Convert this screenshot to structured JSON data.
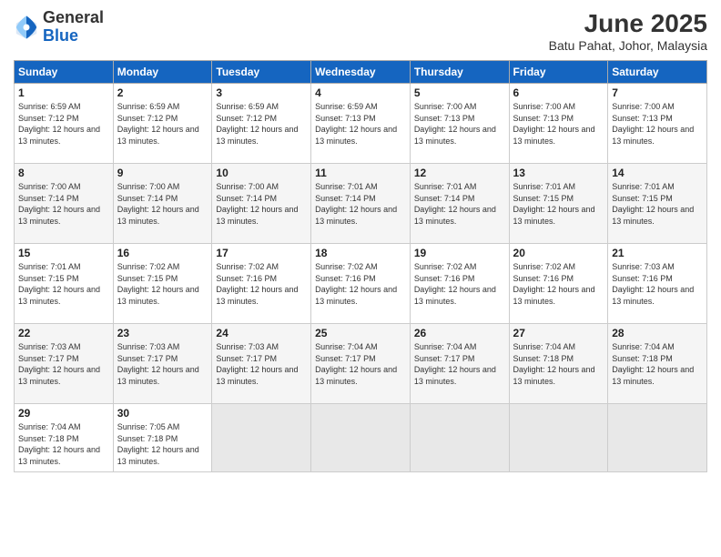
{
  "logo": {
    "general": "General",
    "blue": "Blue"
  },
  "title": "June 2025",
  "subtitle": "Batu Pahat, Johor, Malaysia",
  "weekdays": [
    "Sunday",
    "Monday",
    "Tuesday",
    "Wednesday",
    "Thursday",
    "Friday",
    "Saturday"
  ],
  "weeks": [
    [
      {
        "day": "1",
        "sunrise": "6:59 AM",
        "sunset": "7:12 PM",
        "daylight": "12 hours and 13 minutes."
      },
      {
        "day": "2",
        "sunrise": "6:59 AM",
        "sunset": "7:12 PM",
        "daylight": "12 hours and 13 minutes."
      },
      {
        "day": "3",
        "sunrise": "6:59 AM",
        "sunset": "7:12 PM",
        "daylight": "12 hours and 13 minutes."
      },
      {
        "day": "4",
        "sunrise": "6:59 AM",
        "sunset": "7:13 PM",
        "daylight": "12 hours and 13 minutes."
      },
      {
        "day": "5",
        "sunrise": "7:00 AM",
        "sunset": "7:13 PM",
        "daylight": "12 hours and 13 minutes."
      },
      {
        "day": "6",
        "sunrise": "7:00 AM",
        "sunset": "7:13 PM",
        "daylight": "12 hours and 13 minutes."
      },
      {
        "day": "7",
        "sunrise": "7:00 AM",
        "sunset": "7:13 PM",
        "daylight": "12 hours and 13 minutes."
      }
    ],
    [
      {
        "day": "8",
        "sunrise": "7:00 AM",
        "sunset": "7:14 PM",
        "daylight": "12 hours and 13 minutes."
      },
      {
        "day": "9",
        "sunrise": "7:00 AM",
        "sunset": "7:14 PM",
        "daylight": "12 hours and 13 minutes."
      },
      {
        "day": "10",
        "sunrise": "7:00 AM",
        "sunset": "7:14 PM",
        "daylight": "12 hours and 13 minutes."
      },
      {
        "day": "11",
        "sunrise": "7:01 AM",
        "sunset": "7:14 PM",
        "daylight": "12 hours and 13 minutes."
      },
      {
        "day": "12",
        "sunrise": "7:01 AM",
        "sunset": "7:14 PM",
        "daylight": "12 hours and 13 minutes."
      },
      {
        "day": "13",
        "sunrise": "7:01 AM",
        "sunset": "7:15 PM",
        "daylight": "12 hours and 13 minutes."
      },
      {
        "day": "14",
        "sunrise": "7:01 AM",
        "sunset": "7:15 PM",
        "daylight": "12 hours and 13 minutes."
      }
    ],
    [
      {
        "day": "15",
        "sunrise": "7:01 AM",
        "sunset": "7:15 PM",
        "daylight": "12 hours and 13 minutes."
      },
      {
        "day": "16",
        "sunrise": "7:02 AM",
        "sunset": "7:15 PM",
        "daylight": "12 hours and 13 minutes."
      },
      {
        "day": "17",
        "sunrise": "7:02 AM",
        "sunset": "7:16 PM",
        "daylight": "12 hours and 13 minutes."
      },
      {
        "day": "18",
        "sunrise": "7:02 AM",
        "sunset": "7:16 PM",
        "daylight": "12 hours and 13 minutes."
      },
      {
        "day": "19",
        "sunrise": "7:02 AM",
        "sunset": "7:16 PM",
        "daylight": "12 hours and 13 minutes."
      },
      {
        "day": "20",
        "sunrise": "7:02 AM",
        "sunset": "7:16 PM",
        "daylight": "12 hours and 13 minutes."
      },
      {
        "day": "21",
        "sunrise": "7:03 AM",
        "sunset": "7:16 PM",
        "daylight": "12 hours and 13 minutes."
      }
    ],
    [
      {
        "day": "22",
        "sunrise": "7:03 AM",
        "sunset": "7:17 PM",
        "daylight": "12 hours and 13 minutes."
      },
      {
        "day": "23",
        "sunrise": "7:03 AM",
        "sunset": "7:17 PM",
        "daylight": "12 hours and 13 minutes."
      },
      {
        "day": "24",
        "sunrise": "7:03 AM",
        "sunset": "7:17 PM",
        "daylight": "12 hours and 13 minutes."
      },
      {
        "day": "25",
        "sunrise": "7:04 AM",
        "sunset": "7:17 PM",
        "daylight": "12 hours and 13 minutes."
      },
      {
        "day": "26",
        "sunrise": "7:04 AM",
        "sunset": "7:17 PM",
        "daylight": "12 hours and 13 minutes."
      },
      {
        "day": "27",
        "sunrise": "7:04 AM",
        "sunset": "7:18 PM",
        "daylight": "12 hours and 13 minutes."
      },
      {
        "day": "28",
        "sunrise": "7:04 AM",
        "sunset": "7:18 PM",
        "daylight": "12 hours and 13 minutes."
      }
    ],
    [
      {
        "day": "29",
        "sunrise": "7:04 AM",
        "sunset": "7:18 PM",
        "daylight": "12 hours and 13 minutes."
      },
      {
        "day": "30",
        "sunrise": "7:05 AM",
        "sunset": "7:18 PM",
        "daylight": "12 hours and 13 minutes."
      },
      null,
      null,
      null,
      null,
      null
    ]
  ]
}
